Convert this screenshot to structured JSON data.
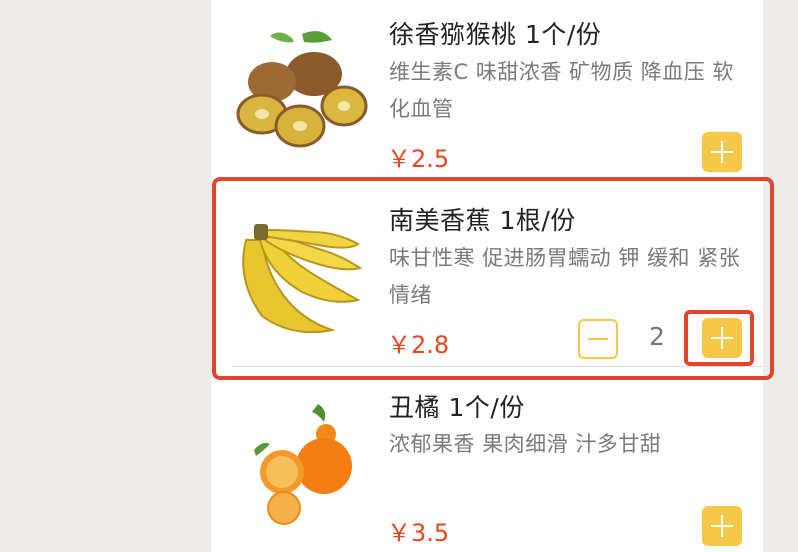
{
  "products": [
    {
      "name": "徐香猕猴桃 1个/份",
      "description": "维生素C 味甜浓香 矿物质 降血压 软化血管",
      "price": "￥2.5",
      "image": "kiwi-fruit-image"
    },
    {
      "name": "南美香蕉 1根/份",
      "description": "味甘性寒 促进肠胃蠕动 钾 缓和 紧张情绪",
      "price": "￥2.8",
      "quantity": "2",
      "image": "banana-bunch-image"
    },
    {
      "name": "丑橘 1个/份",
      "description": "浓郁果香 果肉细滑 汁多甘甜",
      "price": "￥3.5",
      "image": "orange-tangerine-image"
    }
  ],
  "colors": {
    "accent": "#f5c84a",
    "price": "#e8471f",
    "highlight": "#e2452b"
  }
}
